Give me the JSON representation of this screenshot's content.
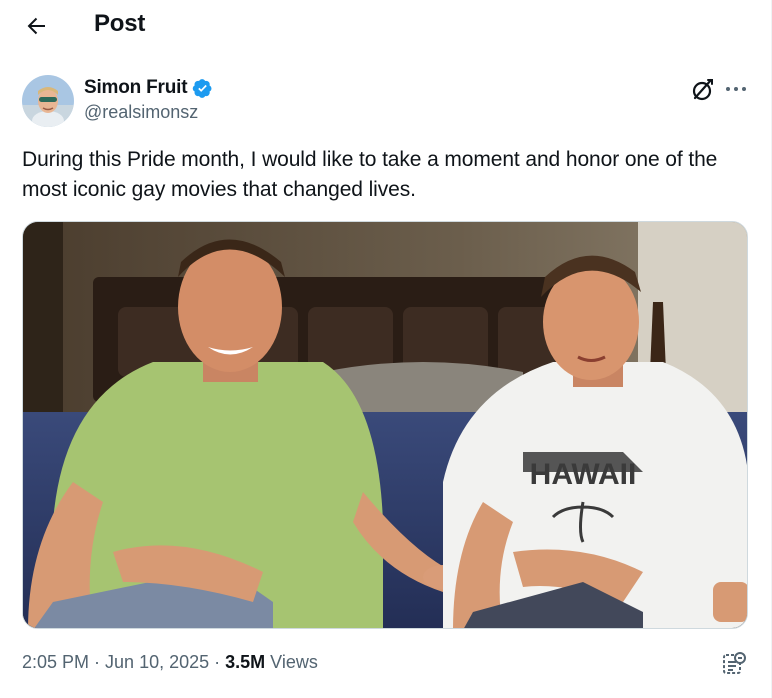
{
  "header": {
    "title": "Post",
    "back_icon": "arrow-left-icon"
  },
  "author": {
    "name": "Simon Fruit",
    "handle": "@realsimonsz",
    "verified": true,
    "verified_color": "#1d9bf0"
  },
  "tweet": {
    "text": "During this Pride month, I would like to take a moment and honor one of the most iconic gay movies that changed lives.",
    "shirt_print": "HAWAII"
  },
  "meta": {
    "time": "2:05 PM",
    "date": "Jun 10, 2025",
    "views_count": "3.5M",
    "views_label": "Views"
  },
  "icons": {
    "grok": "grok-icon",
    "more": "more-icon",
    "analytics": "analytics-icon"
  }
}
